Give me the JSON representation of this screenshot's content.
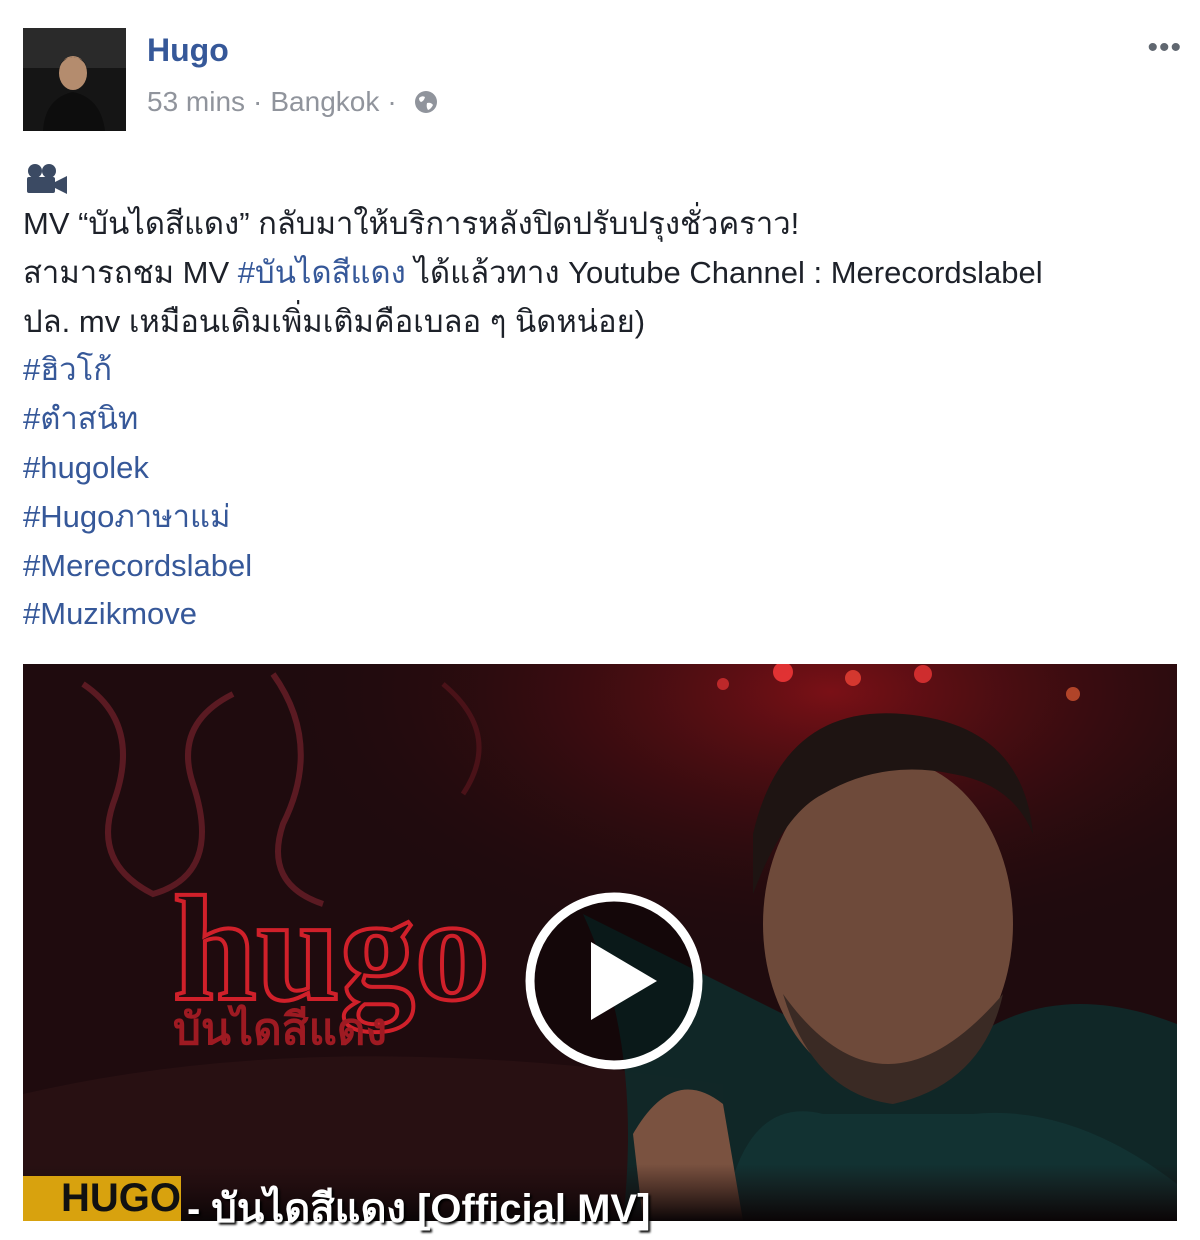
{
  "post": {
    "author": "Hugo",
    "time": "53 mins",
    "location": "Bangkok",
    "separator": "·",
    "privacy_icon": "globe-icon",
    "more_icon": "more-horizontal-icon",
    "more_label": "•••"
  },
  "body": {
    "emoji_icon": "movie-camera-icon",
    "line1": "MV “บันไดสีแดง” กลับมาให้บริการหลังปิดปรับปรุงชั่วคราว!",
    "line2_prefix": "สามารถชม MV ",
    "line2_tag": "#บันไดสีแดง",
    "line2_suffix": " ได้แล้วทาง Youtube Channel : Merecordslabel",
    "line3": "ปล. mv เหมือนเดิมเพิ่มเติมคือเบลอ ๆ นิดหน่อย)",
    "hashtags": [
      "#ฮิวโก้",
      "#ตำสนิท",
      "#hugolek",
      "#Hugoภาษาแม่",
      "#Merecordslabel",
      "#Muzikmove"
    ]
  },
  "video": {
    "overlay_title": "hugo",
    "overlay_subtitle": "บันไดสีแดง",
    "caption_artist": "HUGO",
    "caption_rest": "- บันไดสีแดง [Official MV]",
    "play_icon": "play-icon"
  },
  "colors": {
    "link": "#365899",
    "meta": "#90949c",
    "text": "#1d2129",
    "caption_bg": "#d8a20e"
  }
}
